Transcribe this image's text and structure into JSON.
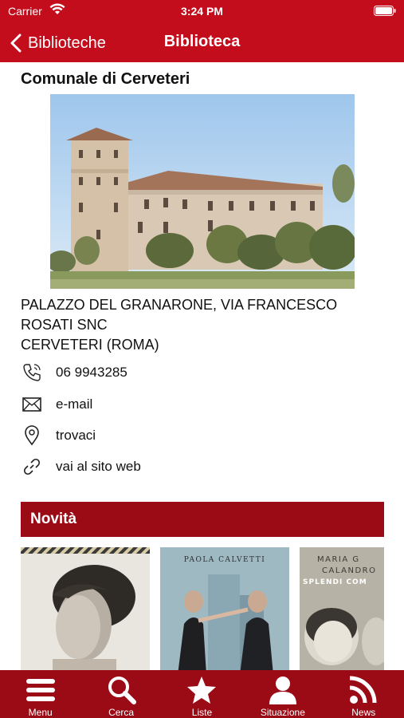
{
  "status_bar": {
    "carrier": "Carrier",
    "time": "3:24 PM"
  },
  "nav": {
    "back_label": "Biblioteche",
    "title": "Biblioteca"
  },
  "library": {
    "name": "Comunale di Cerveteri",
    "address_lines": [
      "PALAZZO DEL GRANARONE, VIA FRANCESCO",
      "ROSATI SNC",
      "CERVETERI (ROMA)"
    ]
  },
  "contacts": [
    {
      "icon": "phone-icon",
      "label": "06 9943285"
    },
    {
      "icon": "envelope-icon",
      "label": "e-mail"
    },
    {
      "icon": "map-pin-icon",
      "label": "trovaci"
    },
    {
      "icon": "link-icon",
      "label": "vai al sito web"
    }
  ],
  "news_section": {
    "title": "Novità",
    "covers": [
      {
        "alt": "book-cover"
      },
      {
        "author": "PAOLA CALVETTI"
      },
      {
        "author": "MARIA G",
        "author_second": "CALANDRO",
        "title": "SPLENDI COM"
      }
    ]
  },
  "tab_bar": {
    "items": [
      {
        "icon": "menu-icon",
        "label": "Menu"
      },
      {
        "icon": "search-icon",
        "label": "Cerca"
      },
      {
        "icon": "star-icon",
        "label": "Liste"
      },
      {
        "icon": "user-icon",
        "label": "Situazione"
      },
      {
        "icon": "rss-icon",
        "label": "News"
      }
    ]
  },
  "colors": {
    "brand_red": "#c30d1c",
    "dark_red": "#9b0b16"
  }
}
